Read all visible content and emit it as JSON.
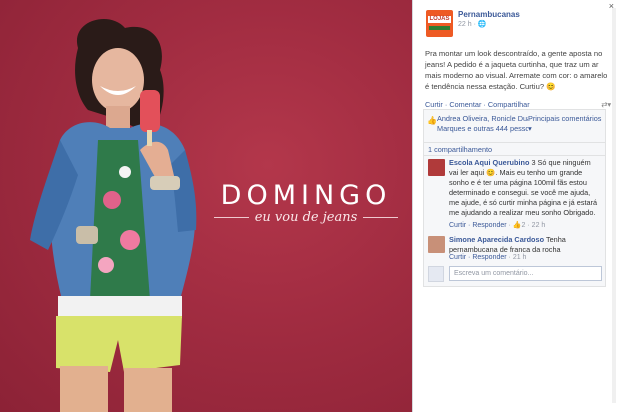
{
  "ad": {
    "title": "DOMINGO",
    "subtitle": "eu vou de jeans"
  },
  "post": {
    "close": "×",
    "page_name": "Pernambucanas",
    "logo_text": "LOJAS",
    "time": "22 h · 🌐",
    "text": "Pra montar um look descontraído, a gente aposta no jeans! A pedido é a jaqueta curtinha, que traz um ar mais moderno ao visual. Arremate com cor: o amarelo é tendência nessa estação. Curtiu? 😊",
    "actions": {
      "like": "Curtir",
      "comment": "Comentar",
      "share": "Compartilhar",
      "separator": " · "
    },
    "likes": "Andrea Oliveira, Ronicle Duarte, Elisangela Marques e outras 444 pessoas curtiram isso.",
    "top_comments": "Principais comentários ▾",
    "shares": "1 compartilhamento"
  },
  "comments": [
    {
      "author": "Escola Aqui Querubino",
      "text": "3 Só que ninguém vai ler aqui 😊. Mais eu tenho um grande sonho e é ter uma página 100mil fãs estou determinado e consegui. se você me ajuda, me ajude, é só curtir minha página e já estará me ajudando a realizar meu sonho Obrigado.",
      "reply": "Curtir · Responder",
      "likes": "2",
      "time": "22 h"
    },
    {
      "author": "Simone Aparecida Cardoso",
      "text": "Tenha pernambucana de franca da rocha",
      "reply": "Curtir · Responder",
      "time": "21 h"
    }
  ],
  "composer": {
    "placeholder": "Escreva um comentário..."
  },
  "colors": {
    "background": "#a12c41",
    "link": "#3b5998",
    "logo": "#ee5a24"
  }
}
